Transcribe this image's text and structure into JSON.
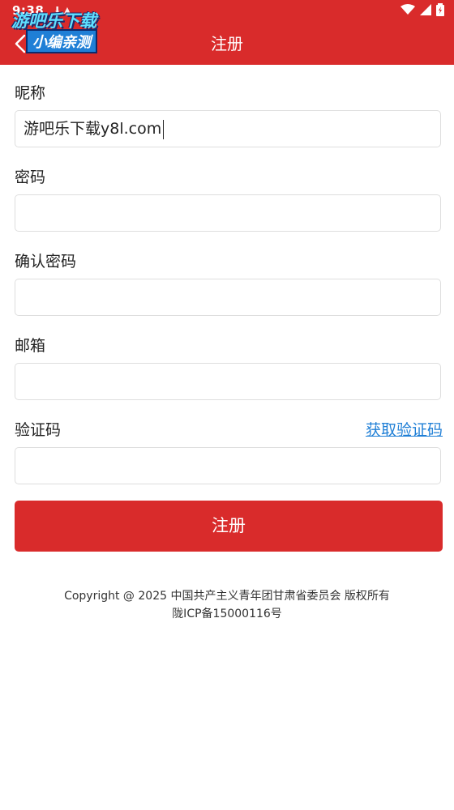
{
  "status_bar": {
    "time": "9:38"
  },
  "watermark": {
    "line1": "游吧乐下载",
    "line2": "小编亲测"
  },
  "header": {
    "title": "注册"
  },
  "form": {
    "nickname_label": "昵称",
    "nickname_value": "游吧乐下载y8l.com",
    "password_label": "密码",
    "confirm_password_label": "确认密码",
    "email_label": "邮箱",
    "code_label": "验证码",
    "get_code_link": "获取验证码",
    "submit_label": "注册"
  },
  "footer": {
    "copyright": "Copyright @ 2025 中国共产主义青年团甘肃省委员会 版权所有",
    "icp": "陇ICP备15000116号"
  },
  "colors": {
    "brand": "#d92b2b",
    "link": "#1f7fd6",
    "field_border": "#dedede"
  }
}
